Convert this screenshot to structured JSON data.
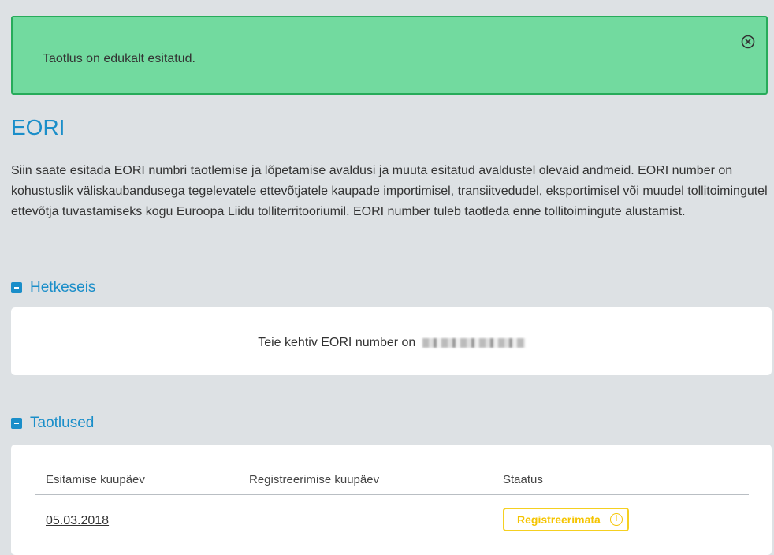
{
  "alert": {
    "message": "Taotlus on edukalt esitatud.",
    "close_icon": "close-circle-icon"
  },
  "page": {
    "title": "EORI",
    "intro": "Siin saate esitada EORI numbri taotlemise ja lõpetamise avaldusi ja muuta esitatud avaldustel olevaid andmeid. EORI number on kohustuslik väliskaubandusega tegelevatele ettevõtjatele kaupade importimisel, transiitvedudel, eksportimisel või muudel tollitoimingutel ettevõtja tuvastamiseks kogu Euroopa Liidu tolliterritooriumil. EORI number tuleb taotleda enne tollitoimingute alustamist."
  },
  "hetkeseis": {
    "heading": "Hetkeseis",
    "eori_text": "Teie kehtiv EORI number on"
  },
  "taotlused": {
    "heading": "Taotlused",
    "columns": [
      "Esitamise kuupäev",
      "Registreerimise kuupäev",
      "Staatus"
    ],
    "rows": [
      {
        "submitted": "05.03.2018",
        "registered": "",
        "status": "Registreerimata",
        "status_icon": "info-icon"
      }
    ]
  },
  "colors": {
    "accent": "#1a8ec9",
    "success_bg": "#72da9f",
    "success_border": "#27ab5a",
    "warning": "#f5c400",
    "background": "#dde1e4"
  }
}
